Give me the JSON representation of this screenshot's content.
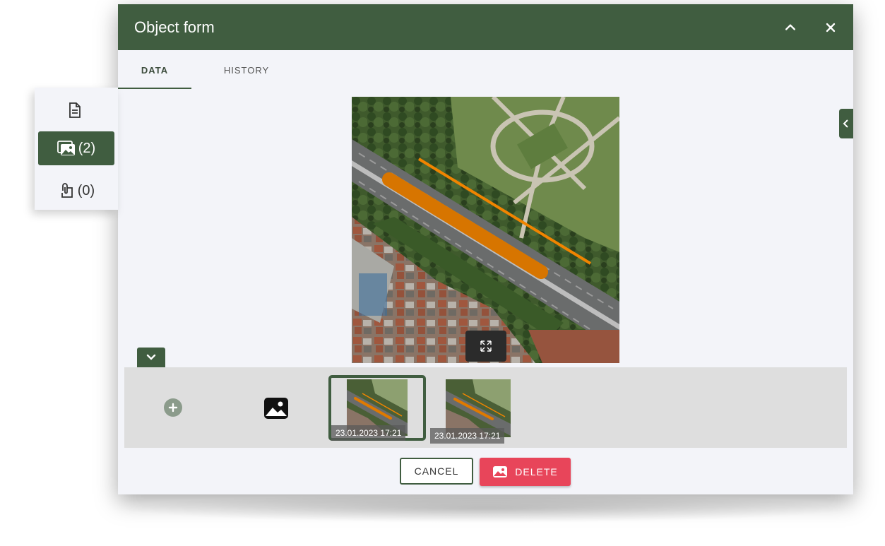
{
  "dialog": {
    "title": "Object form",
    "collapse_icon": "chevron-up-icon",
    "close_icon": "close-icon"
  },
  "tabs": [
    {
      "label": "DATA",
      "active": true
    },
    {
      "label": "HISTORY",
      "active": false
    }
  ],
  "side_panel": {
    "items": [
      {
        "icon": "document-icon",
        "count": ""
      },
      {
        "icon": "image-icon",
        "count": "(2)",
        "active": true
      },
      {
        "icon": "attachment-icon",
        "count": "(0)"
      }
    ]
  },
  "gallery": {
    "thumbnails": [
      {
        "caption": "23.01.2023 17:21",
        "selected": true
      },
      {
        "caption": "23.01.2023 17:21",
        "selected": false
      }
    ]
  },
  "footer": {
    "cancel_label": "CANCEL",
    "delete_label": "DELETE"
  },
  "colors": {
    "primary": "#405d40",
    "danger": "#e8455a",
    "overlay_line": "#e07a00"
  }
}
